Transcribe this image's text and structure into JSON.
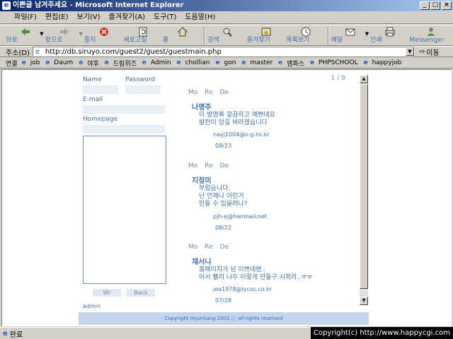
{
  "window": {
    "title": "이쁜글 남겨주세요 - Microsoft Internet Explorer"
  },
  "menu": [
    "파일(F)",
    "편집(E)",
    "보기(V)",
    "즐겨찾기(A)",
    "도구(T)",
    "도움말(H)"
  ],
  "toolbar": {
    "back": "뒤로",
    "forward": "앞으로",
    "stop": "중지",
    "refresh": "새로고침",
    "home": "홈",
    "search": "검색",
    "favorites": "즐겨찾기",
    "history": "목록보기",
    "mail": "메일",
    "print": "인쇄",
    "messenger": "Messenger"
  },
  "address": {
    "label": "주소(D)",
    "url": "http://db.siruyo.com/guest2/guest/guestmain.php",
    "go": "이동"
  },
  "links": {
    "label": "연결",
    "items": [
      "job",
      "Daum",
      "야후",
      "드림위즈",
      "Admin",
      "chollian",
      "gon",
      "master",
      "엠파스",
      "PHPSCHOOL",
      "happyjob"
    ]
  },
  "form": {
    "name_label": "Name",
    "password_label": "Password",
    "email_label": "E-mail",
    "homepage_label": "Homepage",
    "write_button": "Wr",
    "back_button": "Back",
    "admin_link": "admin"
  },
  "guestbook": {
    "page_indicator": "1 / 9",
    "actions": [
      "Mo",
      "Re",
      "De"
    ],
    "entries": [
      {
        "name": "나명주",
        "message": "이 방명록 깔끔하고 예쁘네요\n발전이 있길 바라겠습니다",
        "email": "nayj1004@s-g.hs.kr",
        "date": "08/23"
      },
      {
        "name": "지정미",
        "message": "부럽습니다.\n난 언제나 이런거\n만들 수 있을려나?",
        "email": "pjh-e@hanmail.net",
        "date": "08/22"
      },
      {
        "name": "재서니",
        "message": "홈페이지가 넘 이쁘네염..\n어서 빨리 나두 이렇게 만들구 시퍼라..ㅠㅠ",
        "email": "jea1978@lycos.co.kr",
        "date": "07/28"
      }
    ],
    "footer": "Copyright HyunSang 2001 ⓒ all rights reserved"
  },
  "status": {
    "text": "완료",
    "overlay": "Copyright(c) http://www.happycgi.com"
  }
}
